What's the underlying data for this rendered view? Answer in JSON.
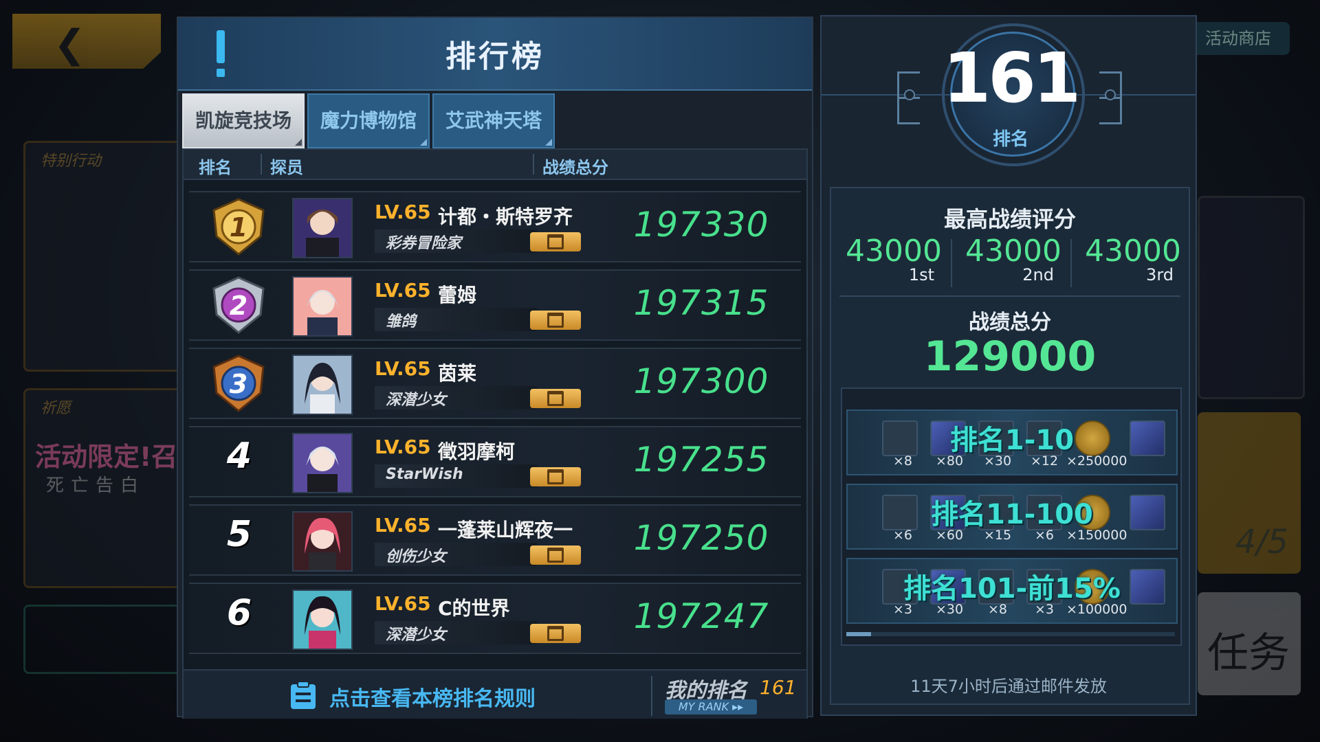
{
  "background": {
    "card1_label": "特别行动",
    "card2_label": "祈愿",
    "card2_promo": "活动限定!召唤",
    "card2_sub": "死亡告白",
    "shop_label": "活动商店",
    "right_fraction": "4/5",
    "right_task": "任务"
  },
  "header": {
    "title": "排行榜"
  },
  "tabs": [
    {
      "label": "凯旋竞技场",
      "active": true
    },
    {
      "label": "魔力博物馆",
      "active": false
    },
    {
      "label": "艾武神天塔",
      "active": false
    }
  ],
  "columns": {
    "rank": "排名",
    "agent": "探员",
    "score": "战绩总分"
  },
  "rows": [
    {
      "rank": "1",
      "level": "LV.65",
      "name": "计都・斯特罗齐",
      "title": "彩券冒险家",
      "score": "197330"
    },
    {
      "rank": "2",
      "level": "LV.65",
      "name": "蕾姆",
      "title": "雏鸽",
      "score": "197315"
    },
    {
      "rank": "3",
      "level": "LV.65",
      "name": "茵莱",
      "title": "深潜少女",
      "score": "197300"
    },
    {
      "rank": "4",
      "level": "LV.65",
      "name": "徵羽摩柯",
      "title": "StarWish",
      "score": "197255"
    },
    {
      "rank": "5",
      "level": "LV.65",
      "name": "一蓬莱山辉夜一",
      "title": "创伤少女",
      "score": "197250"
    },
    {
      "rank": "6",
      "level": "LV.65",
      "name": "C的世界",
      "title": "深潜少女",
      "score": "197247"
    }
  ],
  "footer": {
    "rules_link": "点击查看本榜排名规则",
    "my_rank_label": "我的排名",
    "my_rank_value": "161",
    "my_rank_en": "MY RANK ▸▸"
  },
  "my_rank": {
    "value": "161",
    "label": "排名"
  },
  "best": {
    "title": "最高战绩评分",
    "entries": [
      {
        "value": "43000",
        "place": "1st"
      },
      {
        "value": "43000",
        "place": "2nd"
      },
      {
        "value": "43000",
        "place": "3rd"
      }
    ],
    "total_label": "战绩总分",
    "total_value": "129000"
  },
  "rewards": [
    {
      "label": "排名1-10",
      "qty": [
        "×8",
        "×80",
        "×30",
        "×12",
        "×250000"
      ]
    },
    {
      "label": "排名11-100",
      "qty": [
        "×6",
        "×60",
        "×15",
        "×6",
        "×150000"
      ]
    },
    {
      "label": "排名101-前15%",
      "qty": [
        "×3",
        "×30",
        "×8",
        "×3",
        "×100000"
      ]
    }
  ],
  "mail_note": "11天7小时后通过邮件发放",
  "colors": {
    "score_green": "#48e08c",
    "level_orange": "#ffb22c",
    "tab_blue": "#2a5b82",
    "badge_gold": "#d6a23a",
    "badge_silver": "#b9c2cc",
    "badge_bronze": "#c9782f"
  }
}
